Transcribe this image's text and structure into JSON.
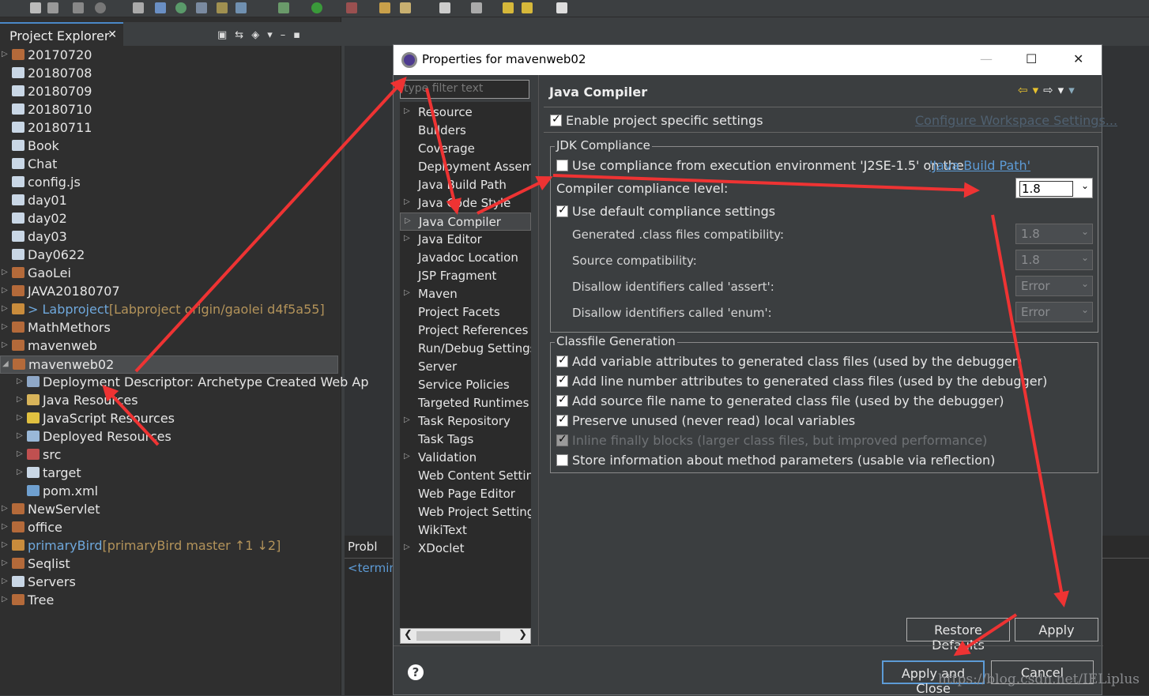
{
  "project_explorer": {
    "title": "Project Explorer",
    "items": [
      {
        "label": "20170720",
        "icon": "project-icon",
        "twisty": true
      },
      {
        "label": "20180708",
        "icon": "folder-icon",
        "twisty": false
      },
      {
        "label": "20180709",
        "icon": "folder-icon",
        "twisty": false
      },
      {
        "label": "20180710",
        "icon": "folder-icon",
        "twisty": false
      },
      {
        "label": "20180711",
        "icon": "folder-icon",
        "twisty": false
      },
      {
        "label": "Book",
        "icon": "folder-icon",
        "twisty": false
      },
      {
        "label": "Chat",
        "icon": "folder-icon",
        "twisty": false
      },
      {
        "label": "config.js",
        "icon": "folder-icon",
        "twisty": false
      },
      {
        "label": "day01",
        "icon": "folder-icon",
        "twisty": false
      },
      {
        "label": "day02",
        "icon": "folder-icon",
        "twisty": false
      },
      {
        "label": "day03",
        "icon": "folder-icon",
        "twisty": false
      },
      {
        "label": "Day0622",
        "icon": "folder-icon",
        "twisty": false
      },
      {
        "label": "GaoLei",
        "icon": "project-icon",
        "twisty": true
      },
      {
        "label": "JAVA20180707",
        "icon": "project-icon",
        "twisty": true
      },
      {
        "label": "> Labproject",
        "icon": "git-project-icon",
        "twisty": true,
        "git": "[Labproject origin/gaolei d4f5a55]"
      },
      {
        "label": "MathMethors",
        "icon": "project-icon",
        "twisty": true
      },
      {
        "label": "mavenweb",
        "icon": "project-icon",
        "twisty": true
      },
      {
        "label": "mavenweb02",
        "icon": "project-icon",
        "twisty": true,
        "expanded": true
      },
      {
        "label": "Deployment Descriptor: Archetype Created Web Ap",
        "icon": "descriptor-icon",
        "twisty": true,
        "child": true
      },
      {
        "label": "Java Resources",
        "icon": "java-res-icon",
        "twisty": true,
        "child": true
      },
      {
        "label": "JavaScript Resources",
        "icon": "js-res-icon",
        "twisty": true,
        "child": true
      },
      {
        "label": "Deployed Resources",
        "icon": "deployed-icon",
        "twisty": true,
        "child": true
      },
      {
        "label": "src",
        "icon": "src-folder-icon",
        "twisty": true,
        "child": true
      },
      {
        "label": "target",
        "icon": "folder-icon",
        "twisty": true,
        "child": true
      },
      {
        "label": "pom.xml",
        "icon": "xml-file-icon",
        "twisty": false,
        "child": true
      },
      {
        "label": "NewServlet",
        "icon": "project-icon",
        "twisty": true
      },
      {
        "label": "office",
        "icon": "project-icon",
        "twisty": true
      },
      {
        "label": "primaryBird",
        "icon": "git-project-icon",
        "twisty": true,
        "git": "[primaryBird master ↑1 ↓2]"
      },
      {
        "label": "Seqlist",
        "icon": "project-icon",
        "twisty": true
      },
      {
        "label": "Servers",
        "icon": "folder-icon",
        "twisty": true
      },
      {
        "label": "Tree",
        "icon": "project-icon",
        "twisty": true
      }
    ]
  },
  "console": {
    "tab_label": "Probl",
    "line": "<termin"
  },
  "dialog": {
    "title": "Properties for mavenweb02",
    "filter_placeholder": "type filter text",
    "nav_items": [
      {
        "label": "Resource",
        "twisty": true
      },
      {
        "label": "Builders",
        "twisty": false
      },
      {
        "label": "Coverage",
        "twisty": false
      },
      {
        "label": "Deployment Assem",
        "twisty": false
      },
      {
        "label": "Java Build Path",
        "twisty": false
      },
      {
        "label": "Java Code Style",
        "twisty": true
      },
      {
        "label": "Java Compiler",
        "twisty": true,
        "active": true
      },
      {
        "label": "Java Editor",
        "twisty": true
      },
      {
        "label": "Javadoc Location",
        "twisty": false
      },
      {
        "label": "JSP Fragment",
        "twisty": false
      },
      {
        "label": "Maven",
        "twisty": true
      },
      {
        "label": "Project Facets",
        "twisty": false
      },
      {
        "label": "Project References",
        "twisty": false
      },
      {
        "label": "Run/Debug Settings",
        "twisty": false
      },
      {
        "label": "Server",
        "twisty": false
      },
      {
        "label": "Service Policies",
        "twisty": false
      },
      {
        "label": "Targeted Runtimes",
        "twisty": false
      },
      {
        "label": "Task Repository",
        "twisty": true
      },
      {
        "label": "Task Tags",
        "twisty": false
      },
      {
        "label": "Validation",
        "twisty": true
      },
      {
        "label": "Web Content Settin",
        "twisty": false
      },
      {
        "label": "Web Page Editor",
        "twisty": false
      },
      {
        "label": "Web Project Setting",
        "twisty": false
      },
      {
        "label": "WikiText",
        "twisty": false
      },
      {
        "label": "XDoclet",
        "twisty": true
      }
    ],
    "page_title": "Java Compiler",
    "enable_specific": "Enable project specific settings",
    "configure_link": "Configure Workspace Settings...",
    "jdk": {
      "group_label": "JDK Compliance",
      "use_env": "Use compliance from execution environment 'J2SE-1.5' on the ",
      "build_path_link": "'Java Build Path'",
      "level_label": "Compiler compliance level:",
      "level_value": "1.8",
      "use_default": "Use default compliance settings",
      "generated_label": "Generated .class files compatibility:",
      "generated_value": "1.8",
      "source_label": "Source compatibility:",
      "source_value": "1.8",
      "assert_label": "Disallow identifiers called 'assert':",
      "assert_value": "Error",
      "enum_label": "Disallow identifiers called 'enum':",
      "enum_value": "Error"
    },
    "classfile": {
      "group_label": "Classfile Generation",
      "options": [
        {
          "label": "Add variable attributes to generated class files (used by the debugger)",
          "checked": true,
          "disabled": false
        },
        {
          "label": "Add line number attributes to generated class files (used by the debugger)",
          "checked": true,
          "disabled": false
        },
        {
          "label": "Add source file name to generated class file (used by the debugger)",
          "checked": true,
          "disabled": false
        },
        {
          "label": "Preserve unused (never read) local variables",
          "checked": true,
          "disabled": false
        },
        {
          "label": "Inline finally blocks (larger class files, but improved performance)",
          "checked": true,
          "disabled": true
        },
        {
          "label": "Store information about method parameters (usable via reflection)",
          "checked": false,
          "disabled": false
        }
      ]
    },
    "restore_defaults": "Restore Defaults",
    "apply": "Apply",
    "apply_close": "Apply and Close",
    "cancel": "Cancel",
    "help": "?"
  },
  "watermark": "https://blog.csdn.net/IELiplus"
}
